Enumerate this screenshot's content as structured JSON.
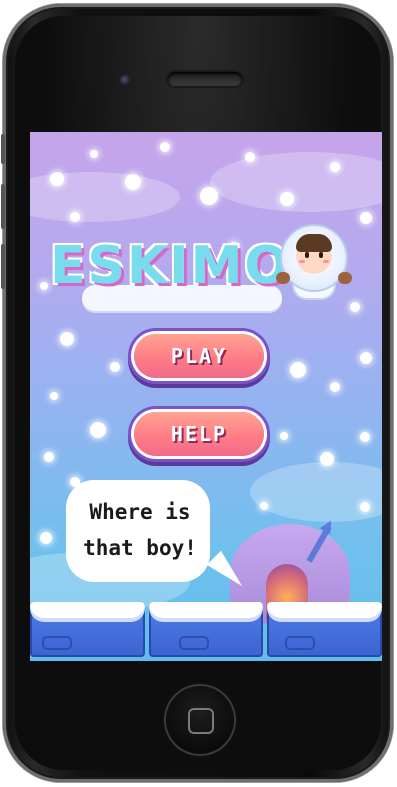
{
  "game": {
    "title": "ESKIMO",
    "buttons": {
      "play_label": "PLAY",
      "help_label": "HELP"
    },
    "speech_bubble": {
      "line1": "Where is",
      "line2": "that boy!"
    }
  },
  "colors": {
    "button_fill": "#ff7a85",
    "button_outline": "#7b52c9",
    "title_fill": "#78dcef",
    "title_outline": "#d469c8",
    "ice_block": "#4f7ee8"
  }
}
